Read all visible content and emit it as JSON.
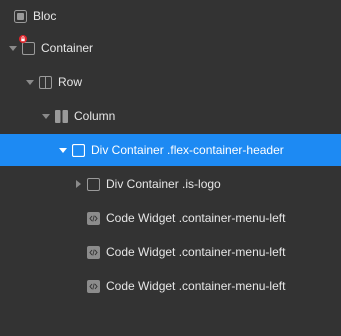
{
  "tree": {
    "items": [
      {
        "label": "Bloc",
        "icon": "bloc-icon",
        "arrow": "none"
      },
      {
        "label": "Container",
        "icon": "container-icon",
        "arrow": "expanded",
        "locked": true
      },
      {
        "label": "Row",
        "icon": "row-icon",
        "arrow": "expanded"
      },
      {
        "label": "Column",
        "icon": "column-icon",
        "arrow": "expanded"
      },
      {
        "label": "Div Container .flex-container-header",
        "icon": "div-container-icon",
        "arrow": "expanded",
        "selected": true
      },
      {
        "label": "Div Container .is-logo",
        "icon": "div-container-icon",
        "arrow": "collapsed"
      },
      {
        "label": "Code Widget .container-menu-left",
        "icon": "code-widget-icon",
        "arrow": "none"
      },
      {
        "label": "Code Widget .container-menu-left",
        "icon": "code-widget-icon",
        "arrow": "none"
      },
      {
        "label": "Code Widget .container-menu-left",
        "icon": "code-widget-icon",
        "arrow": "none"
      }
    ]
  },
  "colors": {
    "background": "#333333",
    "selection": "#1d8af3",
    "text": "#e6e6e6",
    "lock_badge": "#e0242a"
  }
}
